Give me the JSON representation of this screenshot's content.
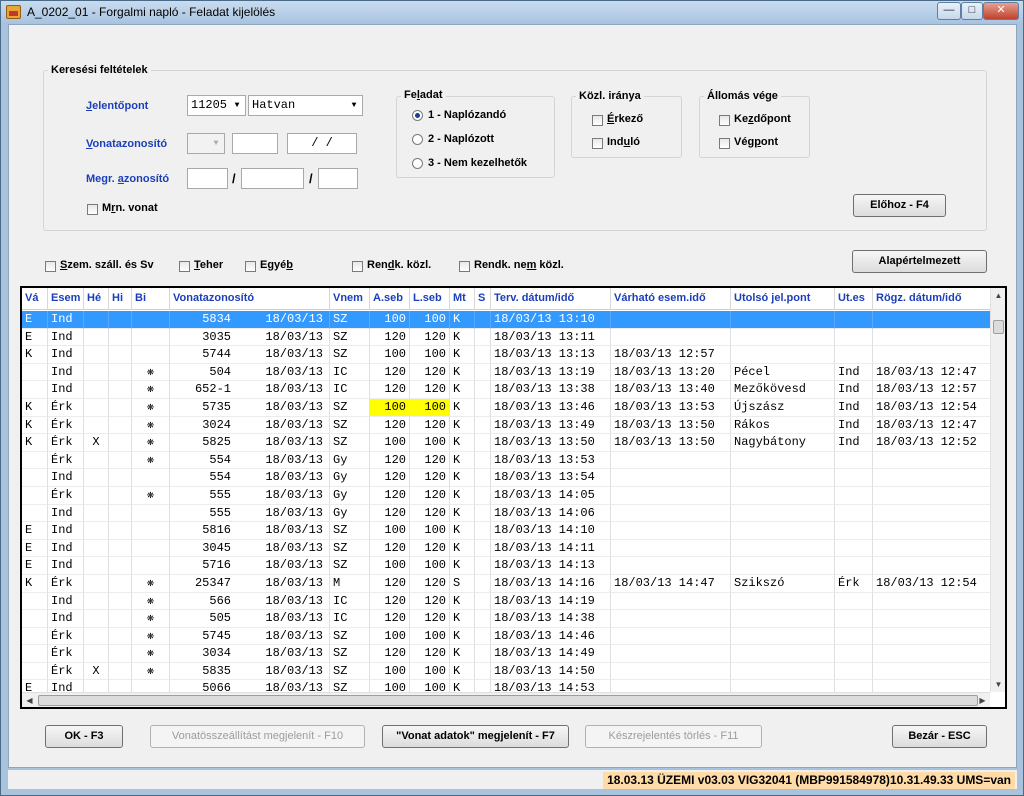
{
  "window": {
    "title": "A_0202_01 - Forgalmi napló - Feladat kijelölés",
    "minimize": "—",
    "maximize": "□",
    "close": "✕"
  },
  "search": {
    "group_title": "Keresési feltételek",
    "jelentopont_label": "Jelentőpont",
    "jelentopont_code": "11205",
    "jelentopont_name": "Hatvan",
    "vonatazonosito_label": "Vonatazonosító",
    "vonat_sep": "/   /",
    "megr_label": "Megr. azonosító",
    "megr_sep1": "/",
    "megr_sep2": "/",
    "mrn_label": "Mrn. vonat"
  },
  "feladat": {
    "title": "Feladat",
    "options": [
      "1 - Naplózandó",
      "2 - Naplózott",
      "3 - Nem kezelhetők"
    ],
    "selected": 0
  },
  "kozl_irany": {
    "title": "Közl. iránya",
    "options": [
      "Érkező",
      "Induló"
    ]
  },
  "allomas_vege": {
    "title": "Állomás vége",
    "options": [
      "Kezdőpont",
      "Végpont"
    ]
  },
  "buttons": {
    "elohoz": "Előhoz - F4",
    "alapertelmezett": "Alapértelmezett",
    "ok": "OK - F3",
    "vonatossze": "Vonatösszeállítást megjelenít - F10",
    "vonat_adatok": "\"Vonat adatok\" megjelenít - F7",
    "keszjel": "Készrejelentés törlés - F11",
    "bezar": "Bezár - ESC"
  },
  "filters": [
    "Szem. száll. és Sv",
    "Teher",
    "Egyéb",
    "Rendk. közl.",
    "Rendk. nem közl."
  ],
  "table": {
    "headers": [
      "Vá",
      "Esem",
      "Hé",
      "Hi",
      "Bi",
      "Vonatazonosító",
      "Vnem",
      "A.seb",
      "L.seb",
      "Mt",
      "S",
      "Terv. dátum/idő",
      "Várható esem.idő",
      "Utolsó jel.pont",
      "Ut.es",
      "Rögz. dátum/idő"
    ],
    "rows": [
      {
        "va": "E",
        "esem": "Ind",
        "he": "",
        "hi": "",
        "bi": "",
        "vonat": "5834",
        "vdate": "18/03/13",
        "vnem": "SZ",
        "aseb": "100",
        "lseb": "100",
        "mt": "K",
        "s": "",
        "terv": "18/03/13 13:10",
        "varhato": "",
        "utolso": "",
        "utes": "",
        "rogz": ""
      },
      {
        "va": "E",
        "esem": "Ind",
        "he": "",
        "hi": "",
        "bi": "",
        "vonat": "3035",
        "vdate": "18/03/13",
        "vnem": "SZ",
        "aseb": "120",
        "lseb": "120",
        "mt": "K",
        "s": "",
        "terv": "18/03/13 13:11",
        "varhato": "",
        "utolso": "",
        "utes": "",
        "rogz": ""
      },
      {
        "va": "K",
        "esem": "Ind",
        "he": "",
        "hi": "",
        "bi": "",
        "vonat": "5744",
        "vdate": "18/03/13",
        "vnem": "SZ",
        "aseb": "100",
        "lseb": "100",
        "mt": "K",
        "s": "",
        "terv": "18/03/13 13:13",
        "varhato": "18/03/13 12:57",
        "utolso": "",
        "utes": "",
        "rogz": ""
      },
      {
        "va": "",
        "esem": "Ind",
        "he": "",
        "hi": "",
        "bi": "❋",
        "vonat": "504",
        "vdate": "18/03/13",
        "vnem": "IC",
        "aseb": "120",
        "lseb": "120",
        "mt": "K",
        "s": "",
        "terv": "18/03/13 13:19",
        "varhato": "18/03/13 13:20",
        "utolso": "Pécel",
        "utes": "Ind",
        "rogz": "18/03/13 12:47"
      },
      {
        "va": "",
        "esem": "Ind",
        "he": "",
        "hi": "",
        "bi": "❋",
        "vonat": "652-1",
        "vdate": "18/03/13",
        "vnem": "IC",
        "aseb": "120",
        "lseb": "120",
        "mt": "K",
        "s": "",
        "terv": "18/03/13 13:38",
        "varhato": "18/03/13 13:40",
        "utolso": "Mezőkövesd",
        "utes": "Ind",
        "rogz": "18/03/13 12:57"
      },
      {
        "va": "K",
        "esem": "Érk",
        "he": "",
        "hi": "",
        "bi": "❋",
        "vonat": "5735",
        "vdate": "18/03/13",
        "vnem": "SZ",
        "aseb": "100",
        "lseb": "100",
        "mt": "K",
        "s": "",
        "terv": "18/03/13 13:46",
        "varhato": "18/03/13 13:53",
        "utolso": "Újszász",
        "utes": "Ind",
        "rogz": "18/03/13 12:54",
        "hl": true
      },
      {
        "va": "K",
        "esem": "Érk",
        "he": "",
        "hi": "",
        "bi": "❋",
        "vonat": "3024",
        "vdate": "18/03/13",
        "vnem": "SZ",
        "aseb": "120",
        "lseb": "120",
        "mt": "K",
        "s": "",
        "terv": "18/03/13 13:49",
        "varhato": "18/03/13 13:50",
        "utolso": "Rákos",
        "utes": "Ind",
        "rogz": "18/03/13 12:47"
      },
      {
        "va": "K",
        "esem": "Érk",
        "he": "X",
        "hi": "",
        "bi": "❋",
        "vonat": "5825",
        "vdate": "18/03/13",
        "vnem": "SZ",
        "aseb": "100",
        "lseb": "100",
        "mt": "K",
        "s": "",
        "terv": "18/03/13 13:50",
        "varhato": "18/03/13 13:50",
        "utolso": "Nagybátony",
        "utes": "Ind",
        "rogz": "18/03/13 12:52"
      },
      {
        "va": "",
        "esem": "Érk",
        "he": "",
        "hi": "",
        "bi": "❋",
        "vonat": "554",
        "vdate": "18/03/13",
        "vnem": "Gy",
        "aseb": "120",
        "lseb": "120",
        "mt": "K",
        "s": "",
        "terv": "18/03/13 13:53",
        "varhato": "",
        "utolso": "",
        "utes": "",
        "rogz": ""
      },
      {
        "va": "",
        "esem": "Ind",
        "he": "",
        "hi": "",
        "bi": "",
        "vonat": "554",
        "vdate": "18/03/13",
        "vnem": "Gy",
        "aseb": "120",
        "lseb": "120",
        "mt": "K",
        "s": "",
        "terv": "18/03/13 13:54",
        "varhato": "",
        "utolso": "",
        "utes": "",
        "rogz": ""
      },
      {
        "va": "",
        "esem": "Érk",
        "he": "",
        "hi": "",
        "bi": "❋",
        "vonat": "555",
        "vdate": "18/03/13",
        "vnem": "Gy",
        "aseb": "120",
        "lseb": "120",
        "mt": "K",
        "s": "",
        "terv": "18/03/13 14:05",
        "varhato": "",
        "utolso": "",
        "utes": "",
        "rogz": ""
      },
      {
        "va": "",
        "esem": "Ind",
        "he": "",
        "hi": "",
        "bi": "",
        "vonat": "555",
        "vdate": "18/03/13",
        "vnem": "Gy",
        "aseb": "120",
        "lseb": "120",
        "mt": "K",
        "s": "",
        "terv": "18/03/13 14:06",
        "varhato": "",
        "utolso": "",
        "utes": "",
        "rogz": ""
      },
      {
        "va": "E",
        "esem": "Ind",
        "he": "",
        "hi": "",
        "bi": "",
        "vonat": "5816",
        "vdate": "18/03/13",
        "vnem": "SZ",
        "aseb": "100",
        "lseb": "100",
        "mt": "K",
        "s": "",
        "terv": "18/03/13 14:10",
        "varhato": "",
        "utolso": "",
        "utes": "",
        "rogz": ""
      },
      {
        "va": "E",
        "esem": "Ind",
        "he": "",
        "hi": "",
        "bi": "",
        "vonat": "3045",
        "vdate": "18/03/13",
        "vnem": "SZ",
        "aseb": "120",
        "lseb": "120",
        "mt": "K",
        "s": "",
        "terv": "18/03/13 14:11",
        "varhato": "",
        "utolso": "",
        "utes": "",
        "rogz": ""
      },
      {
        "va": "E",
        "esem": "Ind",
        "he": "",
        "hi": "",
        "bi": "",
        "vonat": "5716",
        "vdate": "18/03/13",
        "vnem": "SZ",
        "aseb": "100",
        "lseb": "100",
        "mt": "K",
        "s": "",
        "terv": "18/03/13 14:13",
        "varhato": "",
        "utolso": "",
        "utes": "",
        "rogz": ""
      },
      {
        "va": "K",
        "esem": "Érk",
        "he": "",
        "hi": "",
        "bi": "❋",
        "vonat": "25347",
        "vdate": "18/03/13",
        "vnem": "M",
        "aseb": "120",
        "lseb": "120",
        "mt": "S",
        "s": "",
        "terv": "18/03/13 14:16",
        "varhato": "18/03/13 14:47",
        "utolso": "Szikszó",
        "utes": "Érk",
        "rogz": "18/03/13 12:54"
      },
      {
        "va": "",
        "esem": "Ind",
        "he": "",
        "hi": "",
        "bi": "❋",
        "vonat": "566",
        "vdate": "18/03/13",
        "vnem": "IC",
        "aseb": "120",
        "lseb": "120",
        "mt": "K",
        "s": "",
        "terv": "18/03/13 14:19",
        "varhato": "",
        "utolso": "",
        "utes": "",
        "rogz": ""
      },
      {
        "va": "",
        "esem": "Ind",
        "he": "",
        "hi": "",
        "bi": "❋",
        "vonat": "505",
        "vdate": "18/03/13",
        "vnem": "IC",
        "aseb": "120",
        "lseb": "120",
        "mt": "K",
        "s": "",
        "terv": "18/03/13 14:38",
        "varhato": "",
        "utolso": "",
        "utes": "",
        "rogz": ""
      },
      {
        "va": "",
        "esem": "Érk",
        "he": "",
        "hi": "",
        "bi": "❋",
        "vonat": "5745",
        "vdate": "18/03/13",
        "vnem": "SZ",
        "aseb": "100",
        "lseb": "100",
        "mt": "K",
        "s": "",
        "terv": "18/03/13 14:46",
        "varhato": "",
        "utolso": "",
        "utes": "",
        "rogz": ""
      },
      {
        "va": "",
        "esem": "Érk",
        "he": "",
        "hi": "",
        "bi": "❋",
        "vonat": "3034",
        "vdate": "18/03/13",
        "vnem": "SZ",
        "aseb": "120",
        "lseb": "120",
        "mt": "K",
        "s": "",
        "terv": "18/03/13 14:49",
        "varhato": "",
        "utolso": "",
        "utes": "",
        "rogz": ""
      },
      {
        "va": "",
        "esem": "Érk",
        "he": "X",
        "hi": "",
        "bi": "❋",
        "vonat": "5835",
        "vdate": "18/03/13",
        "vnem": "SZ",
        "aseb": "100",
        "lseb": "100",
        "mt": "K",
        "s": "",
        "terv": "18/03/13 14:50",
        "varhato": "",
        "utolso": "",
        "utes": "",
        "rogz": ""
      },
      {
        "va": "E",
        "esem": "Ind",
        "he": "",
        "hi": "",
        "bi": "",
        "vonat": "5066",
        "vdate": "18/03/13",
        "vnem": "SZ",
        "aseb": "100",
        "lseb": "100",
        "mt": "K",
        "s": "",
        "terv": "18/03/13 14:53",
        "varhato": "",
        "utolso": "",
        "utes": "",
        "rogz": ""
      }
    ],
    "selected_row": 0
  },
  "status": {
    "text": "18.03.13 ÜZEMI v03.03 VIG32041 (MBP991584978)10.31.49.33 UMS=van"
  },
  "colors": {
    "selection": "#3399ff",
    "highlight": "#ffff00",
    "label_blue": "#1b3fb8",
    "status_bg": "#ffdba8"
  }
}
